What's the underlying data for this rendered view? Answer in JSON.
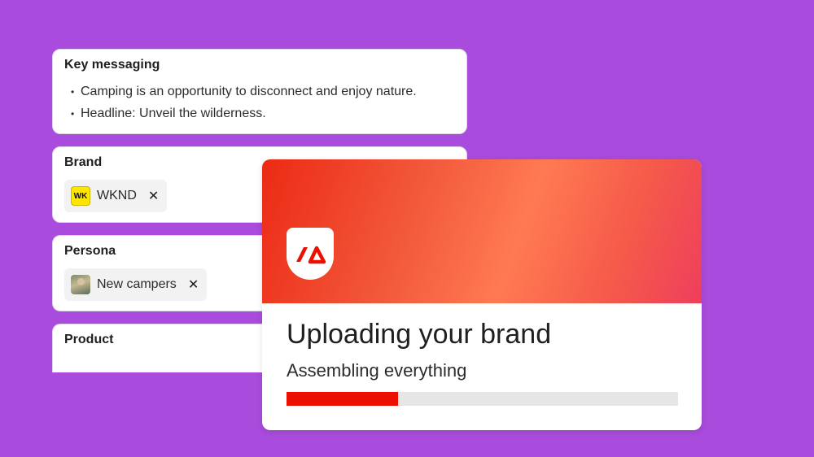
{
  "key_messaging": {
    "title": "Key messaging",
    "bullets": [
      "Camping is an opportunity to disconnect and enjoy nature.",
      "Headline: Unveil the wilderness."
    ]
  },
  "brand": {
    "title": "Brand",
    "chip": {
      "logo_text": "WK",
      "label": "WKND",
      "remove_icon": "close-icon"
    }
  },
  "persona": {
    "title": "Persona",
    "chip": {
      "label": "New campers",
      "remove_icon": "close-icon"
    }
  },
  "product": {
    "title": "Product"
  },
  "upload": {
    "title": "Uploading your brand",
    "subtitle": "Assembling everything",
    "progress": 0.285,
    "app_icon": "adobe-express-icon",
    "accent_color": "#eb1000"
  },
  "colors": {
    "background": "#a94bdc",
    "brand_logo": "#ffe600"
  }
}
